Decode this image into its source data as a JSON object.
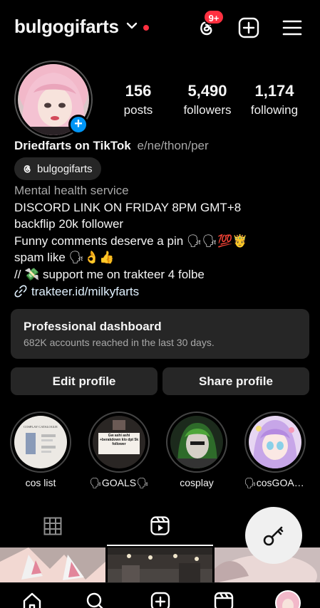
{
  "header": {
    "username": "bulgogifarts",
    "notification_badge": "9+",
    "icons": [
      "chevron-down-icon",
      "threads-icon",
      "add-icon",
      "menu-icon"
    ]
  },
  "profile": {
    "stats": [
      {
        "value": "156",
        "label": "posts"
      },
      {
        "value": "5,490",
        "label": "followers"
      },
      {
        "value": "1,174",
        "label": "following"
      }
    ],
    "display_name": "Driedfarts on TikTok",
    "pronouns": "e/ne/thon/per",
    "threads_handle": "bulgogifarts",
    "category": "Mental health service",
    "bio_lines": [
      "DISCORD LINK ON FRIDAY 8PM GMT+8",
      "backflip 20k follower",
      "Funny comments deserve a pin 🗣🗣💯🤴",
      "spam like 🗣👌👍",
      "// 💸 support me on trakteer 4 folbe"
    ],
    "link": "trakteer.id/milkyfarts"
  },
  "dashboard": {
    "title": "Professional dashboard",
    "subtitle": "682K accounts reached in the last 30 days."
  },
  "actions": {
    "edit": "Edit profile",
    "share": "Share profile"
  },
  "highlights": [
    {
      "label": "cos list",
      "cover_text": "COSPLAY CATALOGUE"
    },
    {
      "label": "🗣GOALS🗣",
      "cover_text": "Gw ashi ashi +berakdown klo dpt 5k follower"
    },
    {
      "label": "cosplay"
    },
    {
      "label": "🗣cosGOALS…"
    }
  ],
  "tabs": [
    "grid-icon",
    "reels-icon",
    "tagged-icon"
  ],
  "colors": {
    "background": "#000000",
    "surface": "#262626",
    "accent_blue": "#0095f6",
    "badge_red": "#ff3040",
    "muted_text": "#a8a8a8"
  }
}
